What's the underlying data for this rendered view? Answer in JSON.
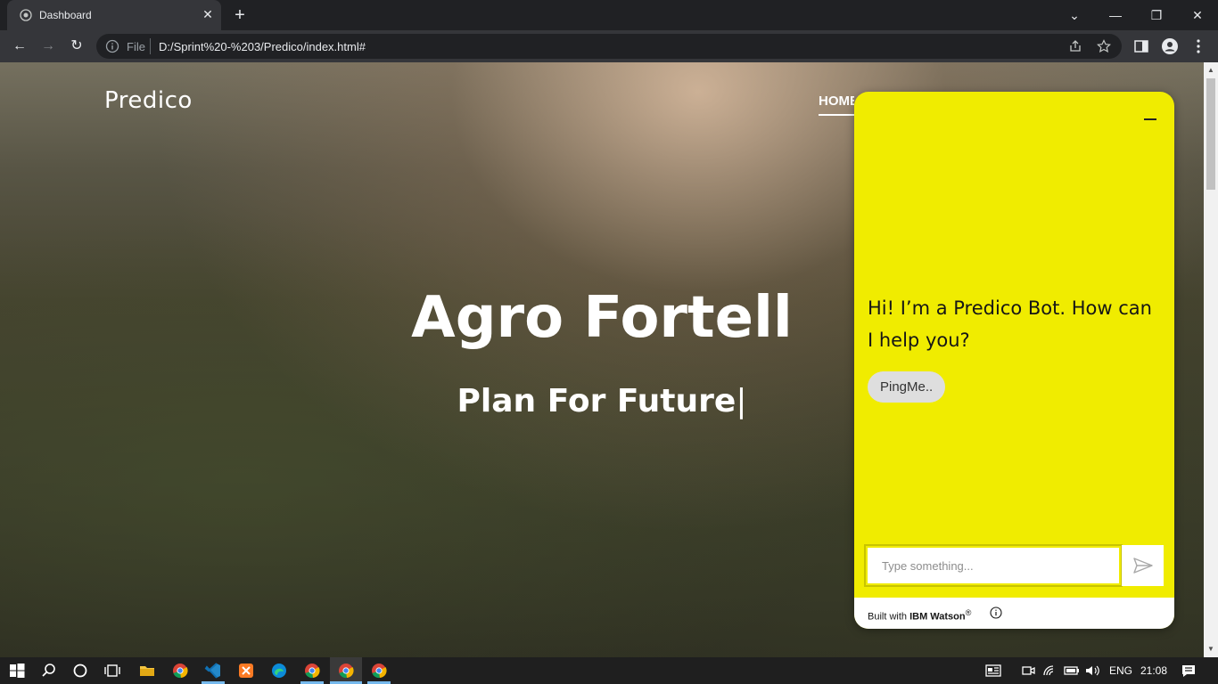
{
  "browser": {
    "tab_title": "Dashboard",
    "scheme_label": "File",
    "url": "D:/Sprint%20-%203/Predico/index.html#"
  },
  "page": {
    "brand": "Predico",
    "nav_home": "HOME",
    "hero_title": "Agro Fortell",
    "hero_subtitle": "Plan For Future",
    "hero_caret": "|"
  },
  "chat": {
    "bot_message": "Hi! I’m a Predico Bot. How can I help you?",
    "quick_reply": "PingMe..",
    "input_placeholder": "Type something...",
    "footer_prefix": "Built with ",
    "footer_brand": "IBM Watson",
    "footer_mark": "®",
    "accent_color": "#f0ec00"
  },
  "taskbar": {
    "language": "ENG",
    "time": "21:08"
  }
}
